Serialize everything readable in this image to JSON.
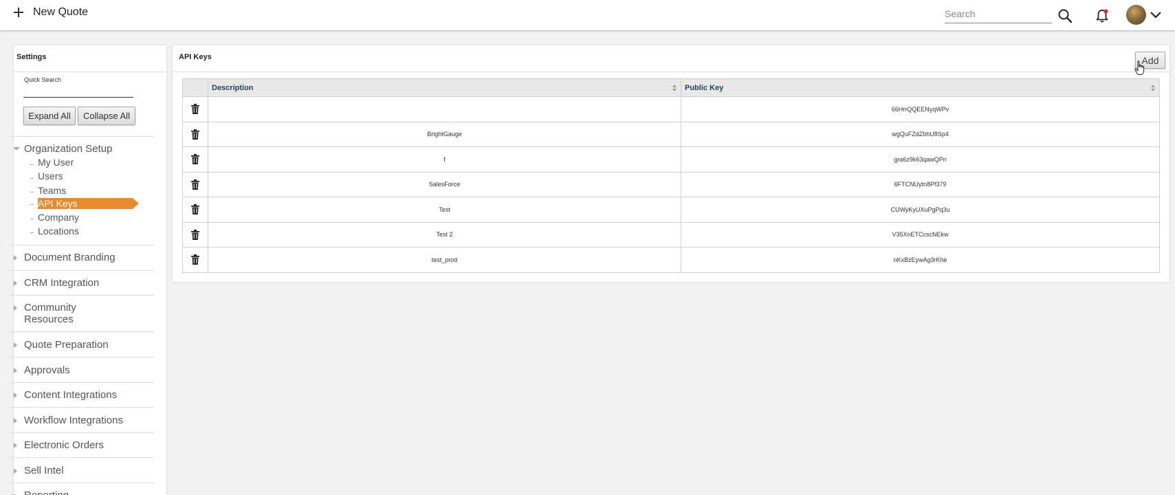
{
  "header": {
    "new_quote_label": "New Quote",
    "search_placeholder": "Search",
    "icons": [
      "plus-icon",
      "search-icon",
      "bell-icon",
      "avatar",
      "chevron-down-icon"
    ],
    "notification_dot_color": "#d32f2f"
  },
  "sidebar": {
    "title": "Settings",
    "quick_search_label": "Quick Search",
    "expand_all_label": "Expand All",
    "collapse_all_label": "Collapse All",
    "active_color": "#e98b2a",
    "groups": [
      {
        "label": "Organization Setup",
        "expanded": true,
        "items": [
          {
            "label": "My User"
          },
          {
            "label": "Users"
          },
          {
            "label": "Teams"
          },
          {
            "label": "API Keys",
            "active": true
          },
          {
            "label": "Company"
          },
          {
            "label": "Locations"
          }
        ]
      },
      {
        "label": "Document Branding"
      },
      {
        "label": "CRM Integration"
      },
      {
        "label": "Community Resources"
      },
      {
        "label": "Quote Preparation"
      },
      {
        "label": "Approvals"
      },
      {
        "label": "Content Integrations"
      },
      {
        "label": "Workflow Integrations"
      },
      {
        "label": "Electronic Orders"
      },
      {
        "label": "Sell Intel"
      },
      {
        "label": "Reporting"
      }
    ]
  },
  "main": {
    "title": "API Keys",
    "add_label": "Add",
    "columns": [
      "Description",
      "Public Key"
    ],
    "rows": [
      {
        "description": "",
        "public_key": "66HrrQQEENyqWPv"
      },
      {
        "description": "BrightGauge",
        "public_key": "wgQuFZdZbhU8Sp4"
      },
      {
        "description": "f",
        "public_key": "gra6z9k63qawQPn"
      },
      {
        "description": "SalesForce",
        "public_key": "6FTCNUytn8Pf379"
      },
      {
        "description": "Test",
        "public_key": "CUWyKyUXuPgPq3u"
      },
      {
        "description": "Test 2",
        "public_key": "V35XnETCcscNEkw"
      },
      {
        "description": "test_prod",
        "public_key": "nKxBzEywAg3rKhe"
      }
    ]
  }
}
